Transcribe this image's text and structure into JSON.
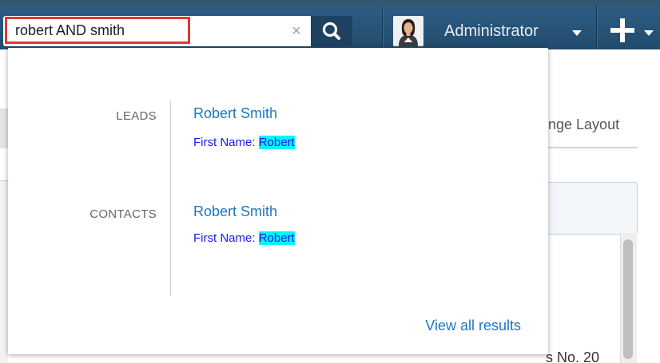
{
  "search": {
    "value": "robert AND smith",
    "clear_symbol": "×"
  },
  "header": {
    "user_name": "Administrator"
  },
  "background": {
    "layout_text": "nge Layout",
    "partial_text": "s No. 20"
  },
  "results": {
    "groups": [
      {
        "module": "LEADS",
        "name": "Robert Smith",
        "field_label": "First Name: ",
        "field_value": "Robert"
      },
      {
        "module": "CONTACTS",
        "name": "Robert Smith",
        "field_label": "First Name: ",
        "field_value": "Robert"
      }
    ],
    "view_all": "View all results"
  },
  "colors": {
    "nav_bar": "#2a5679",
    "search_highlight_border": "#e23a2c",
    "link": "#1f76c0",
    "match_highlight": "#00f5ff"
  },
  "icons": {
    "search_button": "search-icon",
    "create": "plus-icon",
    "menu_caret": "caret-down-icon"
  }
}
